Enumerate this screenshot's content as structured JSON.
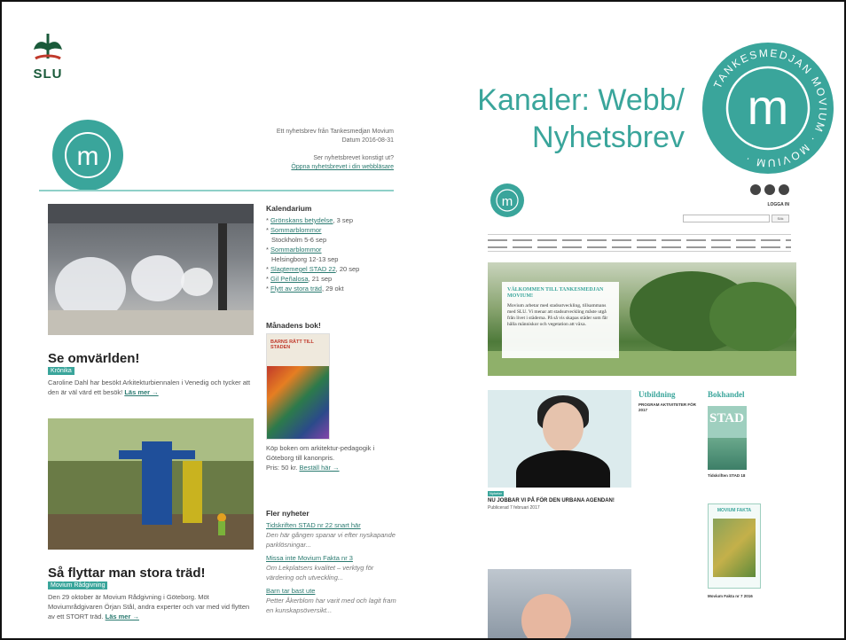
{
  "slide": {
    "logo_text": "SLU",
    "title_line1": "Kanaler: Webb/",
    "title_line2": "Nyhetsbrev",
    "seal_text_top": "TANKESMEDJAN MOVIUM",
    "seal_text_bottom": "MOVIUM",
    "seal_letter": "m"
  },
  "newsletter": {
    "meta_line1": "Ett nyhetsbrev från Tankesmedjan Movium",
    "meta_line2": "Datum 2016-08-31",
    "meta_line3": "Ser nyhetsbrevet konstigt ut?",
    "meta_link": "Öppna nyhetsbrevet i din webbläsare",
    "article1": {
      "headline": "Se omvärlden!",
      "tag": "Krönika",
      "body": "Caroline Dahl har besökt Arkitekturbiennalen i Venedig och tycker att den är väl värd ett besök!",
      "more": "Läs mer →"
    },
    "article2": {
      "headline": "Så flyttar man stora träd!",
      "tag": "Movium Rådgivning",
      "body": "Den 29 oktober är Movium Rådgivning i Göteborg. Möt Moviumrådgivaren Örjan Stål, andra experter och var med vid flytten av ett STORT träd.",
      "more": "Läs mer →"
    },
    "calendar": {
      "title": "Kalendarium",
      "items": [
        {
          "link": "Grönskans betydelse",
          "rest": ", 3 sep"
        },
        {
          "link": "Sommarblommor",
          "rest": ""
        },
        {
          "link": "",
          "rest": "Stockholm 5-6 sep"
        },
        {
          "link": "Sommarblommor",
          "rest": ""
        },
        {
          "link": "",
          "rest": "Helsingborg 12-13 sep"
        },
        {
          "link": "Slagtemegel STAD 22",
          "rest": ", 20 sep"
        },
        {
          "link": "Gil Peñalosa",
          "rest": ", 21 sep"
        },
        {
          "link": "Flytt av stora träd",
          "rest": ", 29 okt"
        }
      ]
    },
    "book": {
      "title": "Månadens bok!",
      "cover_text": "BARNS RÄTT TILL STADEN",
      "body": "Köp boken om arkitektur-pedagogik i Göteborg till kanonpris.",
      "price": "Pris: 50 kr.",
      "price_link": "Beställ här →"
    },
    "more_news": {
      "title": "Fler nyheter",
      "items": [
        {
          "link": "Tidskriften STAD nr 22 snart här",
          "desc": "Den här gången spanar vi efter nyskapande parklösningar..."
        },
        {
          "link": "Missa inte Movium Fakta nr 3",
          "desc": "Om Lekplatsers kvalitet – verktyg för värdering och utveckling..."
        },
        {
          "link": "Barn tar bast ute",
          "desc": "Petter Åkerblom har varit med och lagit fram en kunskapsöversikt..."
        }
      ]
    }
  },
  "website": {
    "login": "LOGGA IN",
    "search_button": "Sök",
    "hero_title": "VÄLKOMMEN TILL TANKESMEDJAN MOVIUM!",
    "hero_text": "Movium arbetar med stadsutveckling, tillsammans med SLU. Vi menar att stadsutveckling måste utgå från livet i städerna. På så vis skapas städer som får hålla människor och vegetation att växa.",
    "news_tag": "Nyheter",
    "news_headline": "NU JOBBAR VI PÅ FÖR DEN URBANA AGENDAN!",
    "news_date": "Publicerad 7 februari 2017",
    "col_education": "Utbildning",
    "col_education_title": "PROGRAM AKTIVITETER FÖR 2017",
    "col_bookstore": "Bokhandel",
    "stad": "STAD",
    "stad_caption": "Tidskriften STAD 18",
    "fakta_title": "MOVIUM FAKTA",
    "fakta_caption": "Movium Fakta nr 7 2016"
  },
  "colors": {
    "accent": "#3aa59b",
    "link": "#2a7a70"
  }
}
